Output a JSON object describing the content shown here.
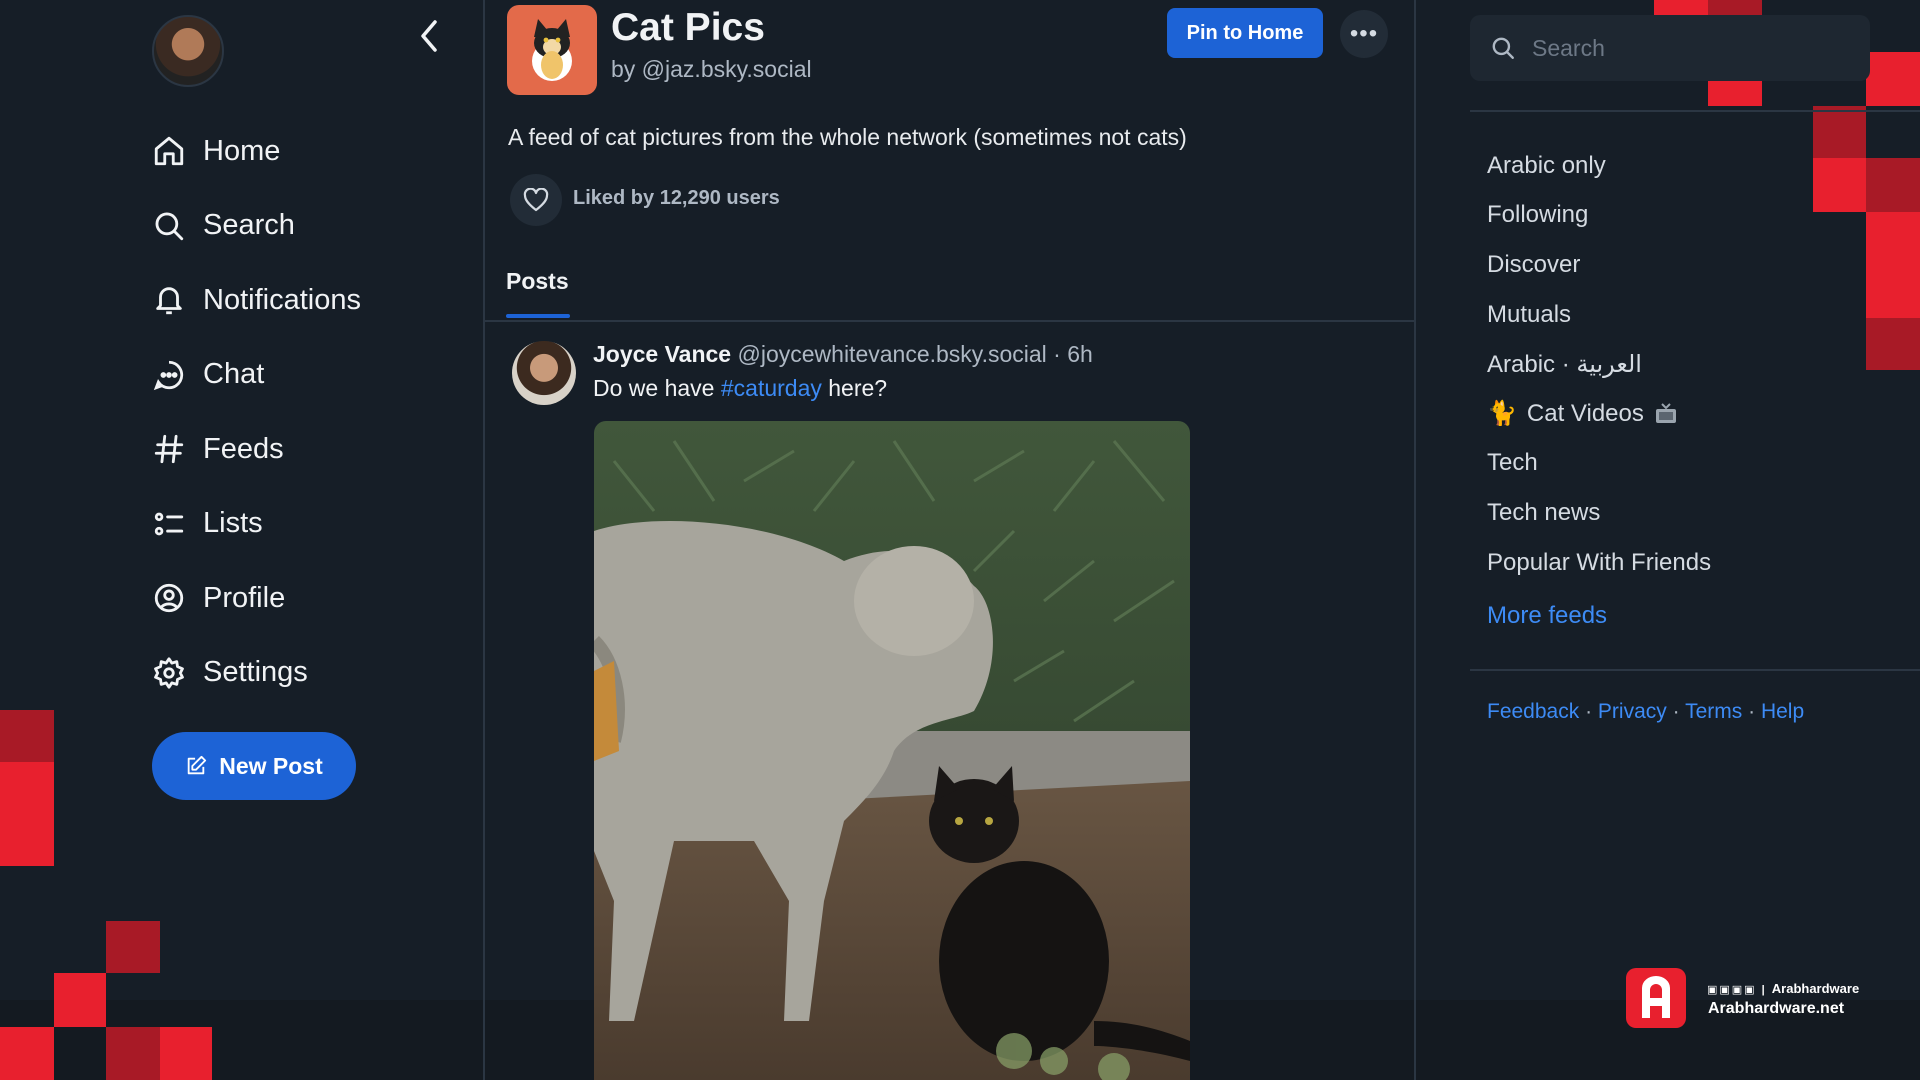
{
  "nav": {
    "items": [
      {
        "label": "Home",
        "icon": "home-icon"
      },
      {
        "label": "Search",
        "icon": "search-icon"
      },
      {
        "label": "Notifications",
        "icon": "bell-icon"
      },
      {
        "label": "Chat",
        "icon": "chat-icon"
      },
      {
        "label": "Feeds",
        "icon": "hash-icon"
      },
      {
        "label": "Lists",
        "icon": "list-icon"
      },
      {
        "label": "Profile",
        "icon": "profile-icon"
      },
      {
        "label": "Settings",
        "icon": "gear-icon"
      }
    ],
    "new_post_label": "New Post"
  },
  "feed": {
    "title": "Cat Pics",
    "by": "by @jaz.bsky.social",
    "pin_label": "Pin to Home",
    "description": "A feed of cat pictures from the whole network (sometimes not cats)",
    "liked_by": "Liked by 12,290 users",
    "tab": "Posts"
  },
  "post": {
    "author_name": "Joyce Vance",
    "author_handle": "@joycewhitevance.bsky.social",
    "time": "· 6h",
    "text_before": "Do we have ",
    "hashtag": "#caturday",
    "text_after": " here?"
  },
  "right": {
    "search_placeholder": "Search",
    "feeds": [
      "Arabic only",
      "Following",
      "Discover",
      "Mutuals",
      "Arabic · العربية",
      "Cat Videos",
      "Tech",
      "Tech news",
      "Popular With Friends"
    ],
    "cat_emoji": "🐈",
    "more_feeds": "More feeds",
    "footer": {
      "feedback": "Feedback",
      "privacy": "Privacy",
      "terms": "Terms",
      "help": "Help",
      "sep": "·"
    }
  },
  "brand": {
    "social": "Arabhardware",
    "site": "Arabhardware.net"
  },
  "colors": {
    "background": "#161e27",
    "accent": "#1d63d6",
    "link": "#3d8bf5",
    "brand_red": "#e8202e"
  }
}
